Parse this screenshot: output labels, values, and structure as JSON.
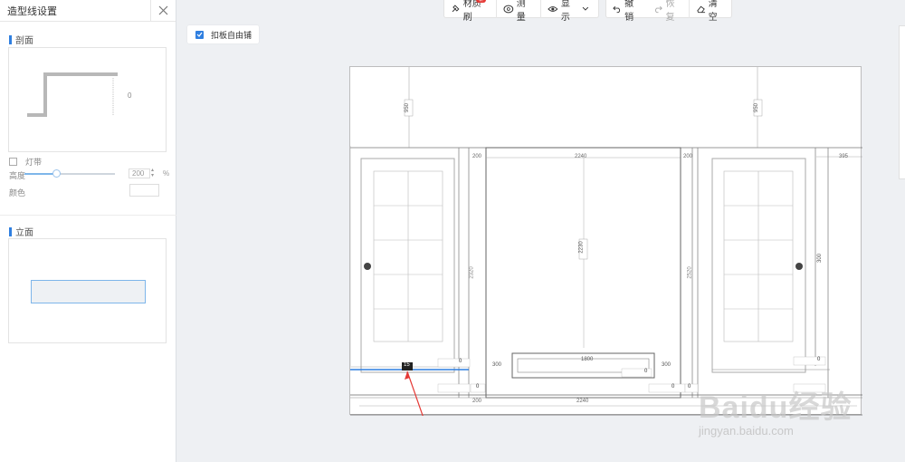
{
  "panel": {
    "title": "造型线设置",
    "section_profile": "剖面",
    "profile_dim": "0",
    "lightstrip_label": "灯带",
    "height_label": "高度",
    "height_value": "200",
    "height_unit": "%",
    "color_label": "颜色",
    "section_elevation": "立面"
  },
  "toolbar": {
    "material_brush": "材质刷",
    "material_badge": "新",
    "measure": "测量",
    "display": "显示",
    "undo": "撤销",
    "redo": "恢复",
    "clear": "清空"
  },
  "options": {
    "free_pave_label": "扣板自由铺",
    "free_pave_checked": true
  },
  "drawing": {
    "dim_top_left": "950",
    "dim_top_right": "950",
    "dim_200_a": "200",
    "dim_2240_top": "2240",
    "dim_200_b": "200",
    "dim_395": "395",
    "dim_2230": "2230",
    "dim_2320": "2320",
    "dim_2520": "2520",
    "dim_300_left": "300",
    "dim_300_right": "300",
    "dim_300_c": "300",
    "dim_2240_bottom": "2240",
    "dim_200_bottom": "200",
    "dim_1800": "1800",
    "selected_label": "15",
    "dim_zero": "0"
  },
  "watermark": {
    "brand": "Baidu经验",
    "url": "jingyan.baidu.com"
  },
  "colors": {
    "accent": "#2f7fe0",
    "annotation_arrow": "#e53935",
    "badge": "#e53935"
  }
}
